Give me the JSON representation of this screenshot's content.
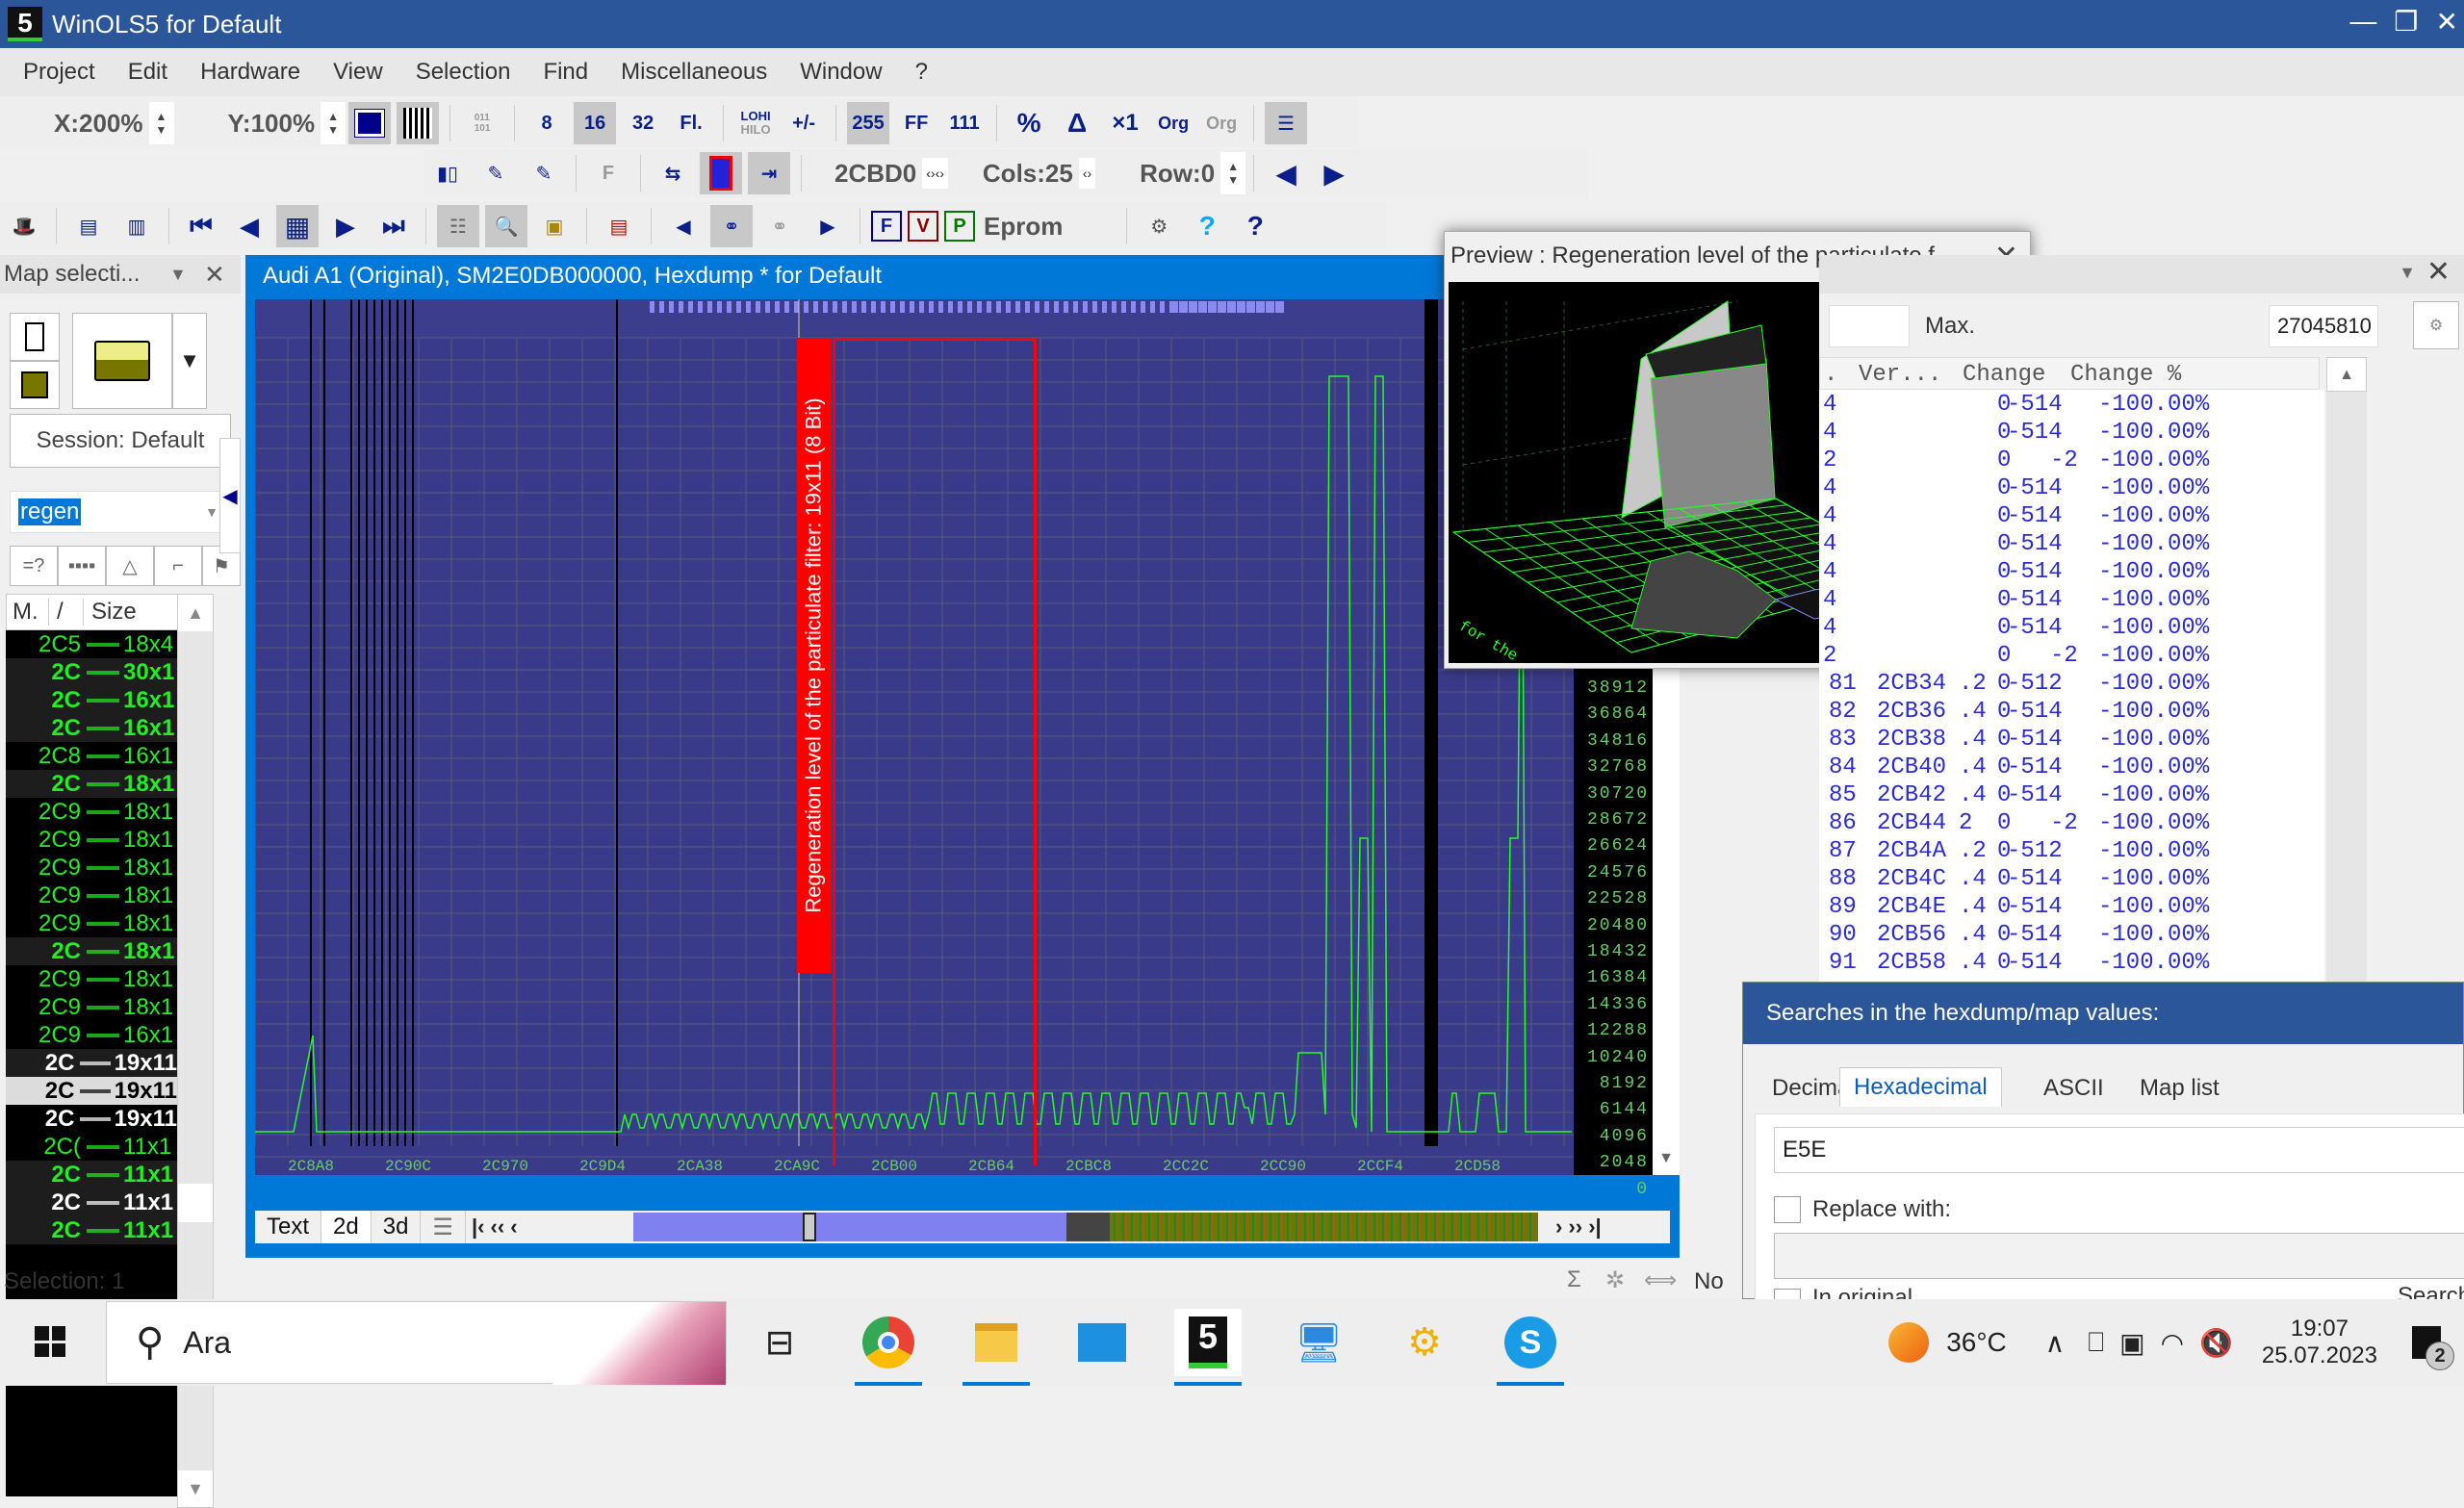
{
  "window": {
    "title": "WinOLS5 for Default",
    "app_icon": "5"
  },
  "menu": [
    "Project",
    "Edit",
    "Hardware",
    "View",
    "Selection",
    "Find",
    "Miscellaneous",
    "Window",
    "?"
  ],
  "toolbar1": {
    "x_zoom": "X:200%",
    "y_zoom": "Y:100%",
    "width_buttons": [
      "8",
      "16",
      "32",
      "Fl."
    ],
    "lohi": "LOHI",
    "hilo": "HILO",
    "sign": "+/-",
    "format_buttons": [
      "255",
      "FF",
      "111"
    ],
    "percent": "%",
    "delta": "Δ",
    "times1": "×1",
    "org1": "Org",
    "org2": "Org"
  },
  "toolbar2": {
    "address": "2CBD0",
    "cols": "Cols:25",
    "row": "Row:0"
  },
  "toolbar3": {
    "eprom": "Eprom",
    "f": "F",
    "v": "V",
    "p": "P"
  },
  "left_panel": {
    "title": "Map selecti...",
    "session": "Session: Default",
    "filter": "regen",
    "columns": [
      "M.",
      "/",
      "Size"
    ],
    "rows": [
      {
        "addr": "2C5",
        "size": "18x4",
        "style": "normal"
      },
      {
        "addr": "2C",
        "size": "30x1",
        "style": "bold-alt"
      },
      {
        "addr": "2C",
        "size": "16x1",
        "style": "bold-alt"
      },
      {
        "addr": "2C",
        "size": "16x1",
        "style": "bold-alt"
      },
      {
        "addr": "2C8",
        "size": "16x1",
        "style": "normal"
      },
      {
        "addr": "2C",
        "size": "18x1",
        "style": "bold-alt"
      },
      {
        "addr": "2C9",
        "size": "18x1",
        "style": "normal"
      },
      {
        "addr": "2C9",
        "size": "18x1",
        "style": "normal"
      },
      {
        "addr": "2C9",
        "size": "18x1",
        "style": "normal"
      },
      {
        "addr": "2C9",
        "size": "18x1",
        "style": "normal"
      },
      {
        "addr": "2C9",
        "size": "18x1",
        "style": "normal"
      },
      {
        "addr": "2C",
        "size": "18x1",
        "style": "bold-alt"
      },
      {
        "addr": "2C9",
        "size": "18x1",
        "style": "normal"
      },
      {
        "addr": "2C9",
        "size": "18x1",
        "style": "normal"
      },
      {
        "addr": "2C9",
        "size": "16x1",
        "style": "normal"
      },
      {
        "addr": "2C",
        "size": "19x11",
        "style": "white-alt"
      },
      {
        "addr": "2C",
        "size": "19x11",
        "style": "selected"
      },
      {
        "addr": "2C",
        "size": "19x11",
        "style": "white"
      },
      {
        "addr": "2C(",
        "size": "11x1",
        "style": "normal"
      },
      {
        "addr": "2C",
        "size": "11x1",
        "style": "bold-alt"
      },
      {
        "addr": "2C",
        "size": "11x1",
        "style": "white-alt"
      },
      {
        "addr": "2C",
        "size": "11x1",
        "style": "bold-alt"
      }
    ]
  },
  "doc": {
    "title": "Audi A1 (Original), SM2E0DB000000, Hexdump * for Default",
    "map_label": "Regeneration level of the particulate filter: 19x11 (8 Bit)",
    "x_ticks": [
      "2C8A8",
      "2C90C",
      "2C970",
      "2C9D4",
      "2CA38",
      "2CA9C",
      "2CB00",
      "2CB64",
      "2CBC8",
      "2CC2C",
      "2CC90",
      "2CCF4",
      "2CD58"
    ],
    "y_ticks": [
      "38912",
      "36864",
      "34816",
      "32768",
      "30720",
      "28672",
      "26624",
      "24576",
      "22528",
      "20480",
      "18432",
      "16384",
      "14336",
      "12288",
      "10240",
      "8192",
      "6144",
      "4096",
      "2048",
      "0"
    ],
    "view_tabs": [
      "Text",
      "2d",
      "3d"
    ],
    "nav_left": "|‹ ‹‹ ‹",
    "nav_right": "› ›› ›|"
  },
  "preview": {
    "title": "Preview : Regeneration level of the particulate f...",
    "caption_left": "for the",
    "caption_right": "...ate f"
  },
  "right_panel": {
    "max_label": "Max.",
    "max_value": "27045810",
    "columns": [
      ".",
      "Ver...",
      "Change",
      "Change %"
    ],
    "rows": [
      {
        "no": "",
        "addr": "",
        "suffix": "4",
        "ver": "0",
        "change": "-514",
        "pct": "-100.00%"
      },
      {
        "no": "",
        "addr": "",
        "suffix": "4",
        "ver": "0",
        "change": "-514",
        "pct": "-100.00%"
      },
      {
        "no": "",
        "addr": "",
        "suffix": "2",
        "ver": "0",
        "change": "-2",
        "pct": "-100.00%"
      },
      {
        "no": "",
        "addr": "",
        "suffix": "4",
        "ver": "0",
        "change": "-514",
        "pct": "-100.00%"
      },
      {
        "no": "",
        "addr": "",
        "suffix": "4",
        "ver": "0",
        "change": "-514",
        "pct": "-100.00%"
      },
      {
        "no": "",
        "addr": "",
        "suffix": "4",
        "ver": "0",
        "change": "-514",
        "pct": "-100.00%"
      },
      {
        "no": "",
        "addr": "",
        "suffix": "4",
        "ver": "0",
        "change": "-514",
        "pct": "-100.00%"
      },
      {
        "no": "",
        "addr": "",
        "suffix": "4",
        "ver": "0",
        "change": "-514",
        "pct": "-100.00%"
      },
      {
        "no": "",
        "addr": "",
        "suffix": "4",
        "ver": "0",
        "change": "-514",
        "pct": "-100.00%"
      },
      {
        "no": "",
        "addr": "",
        "suffix": "2",
        "ver": "0",
        "change": "-2",
        "pct": "-100.00%"
      },
      {
        "no": "81",
        "addr": "2CB34",
        "suffix": ".2",
        "ver": "0",
        "change": "-512",
        "pct": "-100.00%"
      },
      {
        "no": "82",
        "addr": "2CB36",
        "suffix": ".4",
        "ver": "0",
        "change": "-514",
        "pct": "-100.00%"
      },
      {
        "no": "83",
        "addr": "2CB38",
        "suffix": ".4",
        "ver": "0",
        "change": "-514",
        "pct": "-100.00%"
      },
      {
        "no": "84",
        "addr": "2CB40",
        "suffix": ".4",
        "ver": "0",
        "change": "-514",
        "pct": "-100.00%"
      },
      {
        "no": "85",
        "addr": "2CB42",
        "suffix": ".4",
        "ver": "0",
        "change": "-514",
        "pct": "-100.00%"
      },
      {
        "no": "86",
        "addr": "2CB44",
        "suffix": "2",
        "ver": "0",
        "change": "-2",
        "pct": "-100.00%"
      },
      {
        "no": "87",
        "addr": "2CB4A",
        "suffix": ".2",
        "ver": "0",
        "change": "-512",
        "pct": "-100.00%"
      },
      {
        "no": "88",
        "addr": "2CB4C",
        "suffix": ".4",
        "ver": "0",
        "change": "-514",
        "pct": "-100.00%"
      },
      {
        "no": "89",
        "addr": "2CB4E",
        "suffix": ".4",
        "ver": "0",
        "change": "-514",
        "pct": "-100.00%"
      },
      {
        "no": "90",
        "addr": "2CB56",
        "suffix": ".4",
        "ver": "0",
        "change": "-514",
        "pct": "-100.00%"
      },
      {
        "no": "91",
        "addr": "2CB58",
        "suffix": ".4",
        "ver": "0",
        "change": "-514",
        "pct": "-100.00%"
      }
    ]
  },
  "search": {
    "title": "Searches in the hexdump/map values:",
    "tabs": [
      "Decimal",
      "Hexadecimal",
      "ASCII",
      "Map list"
    ],
    "active_tab": "Hexadecimal",
    "value": "E5E",
    "replace_label": "Replace with:",
    "in_original": "In original",
    "search_btn": "Search"
  },
  "status": {
    "selection": "Selection: 1",
    "right": "No C"
  },
  "taskbar": {
    "search_text": "Ara",
    "temperature": "36°C",
    "time": "19:07",
    "date": "25.07.2023",
    "notifications": "2"
  }
}
